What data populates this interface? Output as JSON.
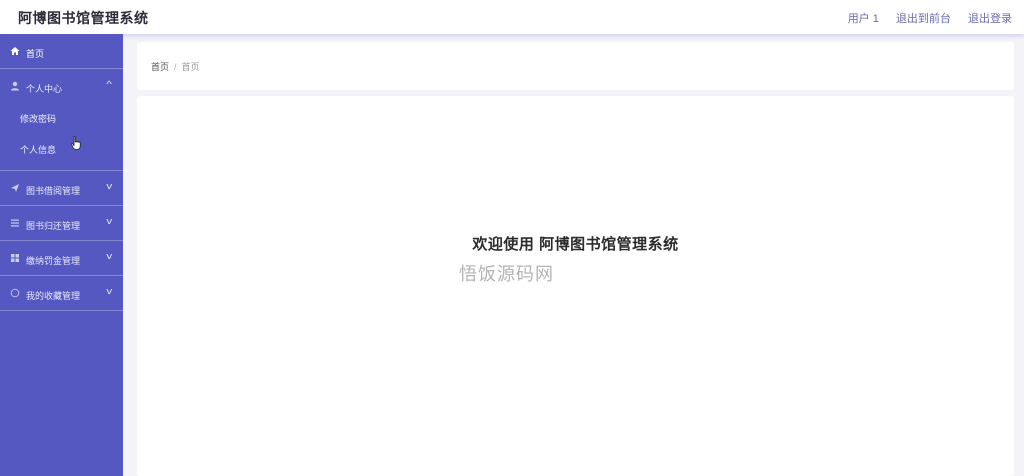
{
  "header": {
    "title": "阿博图书馆管理系统",
    "user": "用户 1",
    "back_to_front": "退出到前台",
    "logout": "退出登录"
  },
  "sidebar": {
    "home": "首页",
    "personal_center": "个人中心",
    "personal_sub": [
      "修改密码",
      "个人信息"
    ],
    "items": [
      "图书借阅管理",
      "图书归还管理",
      "缴纳罚金管理",
      "我的收藏管理"
    ]
  },
  "breadcrumb": {
    "home": "首页",
    "separator": "/",
    "current": "首页"
  },
  "main": {
    "welcome": "欢迎使用 阿博图书馆管理系统",
    "watermark": "悟饭源码网"
  },
  "colors": {
    "sidebar_bg": "#5558c0",
    "accent": "#6b6ba8"
  }
}
